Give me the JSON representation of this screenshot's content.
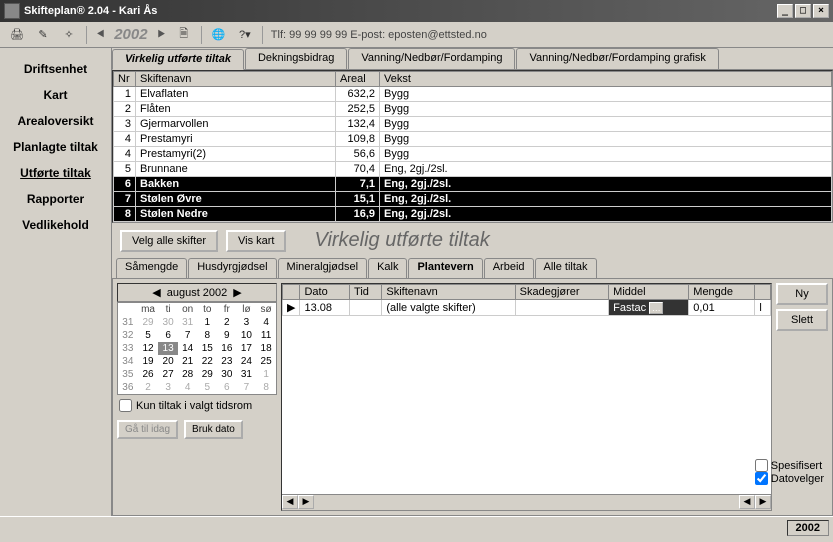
{
  "window": {
    "title": "Skifteplan® 2.04 - Kari Ås"
  },
  "toolbar": {
    "year": "2002",
    "info": "Tlf: 99 99 99 99  E-post: eposten@ettsted.no"
  },
  "sidebar": {
    "items": [
      {
        "label": "Driftsenhet"
      },
      {
        "label": "Kart"
      },
      {
        "label": "Arealoversikt"
      },
      {
        "label": "Planlagte tiltak"
      },
      {
        "label": "Utførte tiltak"
      },
      {
        "label": "Rapporter"
      },
      {
        "label": "Vedlikehold"
      }
    ]
  },
  "tabs1": [
    "Virkelig utførte tiltak",
    "Dekningsbidrag",
    "Vanning/Nedbør/Fordamping",
    "Vanning/Nedbør/Fordamping grafisk"
  ],
  "grid": {
    "headers": {
      "nr": "Nr",
      "navn": "Skiftenavn",
      "areal": "Areal",
      "vekst": "Vekst"
    },
    "rows": [
      {
        "nr": "1",
        "navn": "Elvaflaten",
        "areal": "632,2",
        "vekst": "Bygg",
        "sel": false
      },
      {
        "nr": "2",
        "navn": "Flåten",
        "areal": "252,5",
        "vekst": "Bygg",
        "sel": false
      },
      {
        "nr": "3",
        "navn": "Gjermarvollen",
        "areal": "132,4",
        "vekst": "Bygg",
        "sel": false
      },
      {
        "nr": "4",
        "navn": "Prestamyri",
        "areal": "109,8",
        "vekst": "Bygg",
        "sel": false
      },
      {
        "nr": "4",
        "navn": "Prestamyri(2)",
        "areal": "56,6",
        "vekst": "Bygg",
        "sel": false
      },
      {
        "nr": "5",
        "navn": "Brunnane",
        "areal": "70,4",
        "vekst": "Eng, 2gj./2sl.",
        "sel": false
      },
      {
        "nr": "6",
        "navn": "Bakken",
        "areal": "7,1",
        "vekst": "Eng, 2gj./2sl.",
        "sel": true
      },
      {
        "nr": "7",
        "navn": "Stølen Øvre",
        "areal": "15,1",
        "vekst": "Eng, 2gj./2sl.",
        "sel": true
      },
      {
        "nr": "8",
        "navn": "Stølen Nedre",
        "areal": "16,9",
        "vekst": "Eng, 2gj./2sl.",
        "sel": true
      }
    ]
  },
  "midbar": {
    "btn_all": "Velg alle skifter",
    "btn_map": "Vis kart",
    "title": "Virkelig utførte tiltak"
  },
  "tabs2": [
    "Såmengde",
    "Husdyrgjødsel",
    "Mineralgjødsel",
    "Kalk",
    "Plantevern",
    "Arbeid",
    "Alle tiltak"
  ],
  "calendar": {
    "month": "august 2002",
    "dayhead": [
      "ma",
      "ti",
      "on",
      "to",
      "fr",
      "lø",
      "sø"
    ],
    "weeks": [
      {
        "wk": "31",
        "days": [
          "29",
          "30",
          "31",
          "1",
          "2",
          "3",
          "4"
        ],
        "other": [
          0,
          1,
          2
        ]
      },
      {
        "wk": "32",
        "days": [
          "5",
          "6",
          "7",
          "8",
          "9",
          "10",
          "11"
        ],
        "other": []
      },
      {
        "wk": "33",
        "days": [
          "12",
          "13",
          "14",
          "15",
          "16",
          "17",
          "18"
        ],
        "other": [],
        "today": 1
      },
      {
        "wk": "34",
        "days": [
          "19",
          "20",
          "21",
          "22",
          "23",
          "24",
          "25"
        ],
        "other": []
      },
      {
        "wk": "35",
        "days": [
          "26",
          "27",
          "28",
          "29",
          "30",
          "31",
          "1"
        ],
        "other": [
          6
        ]
      },
      {
        "wk": "36",
        "days": [
          "2",
          "3",
          "4",
          "5",
          "6",
          "7",
          "8"
        ],
        "other": [
          0,
          1,
          2,
          3,
          4,
          5,
          6
        ]
      }
    ],
    "check": "Kun tiltak i valgt tidsrom",
    "btn_today": "Gå til idag",
    "btn_use": "Bruk dato"
  },
  "detail": {
    "headers": [
      "Dato",
      "Tid",
      "Skiftenavn",
      "Skadegjører",
      "Middel",
      "Mengde",
      ""
    ],
    "row": {
      "dato": "13.08",
      "tid": "",
      "skifte": "(alle valgte skifter)",
      "skade": "",
      "middel": "Fastac",
      "mengde": "0,01",
      "unit": "l"
    }
  },
  "rightbtns": {
    "ny": "Ny",
    "slett": "Slett"
  },
  "rightchecks": {
    "spes": "Spesifisert",
    "dato": "Datovelger"
  },
  "status": {
    "year": "2002"
  }
}
